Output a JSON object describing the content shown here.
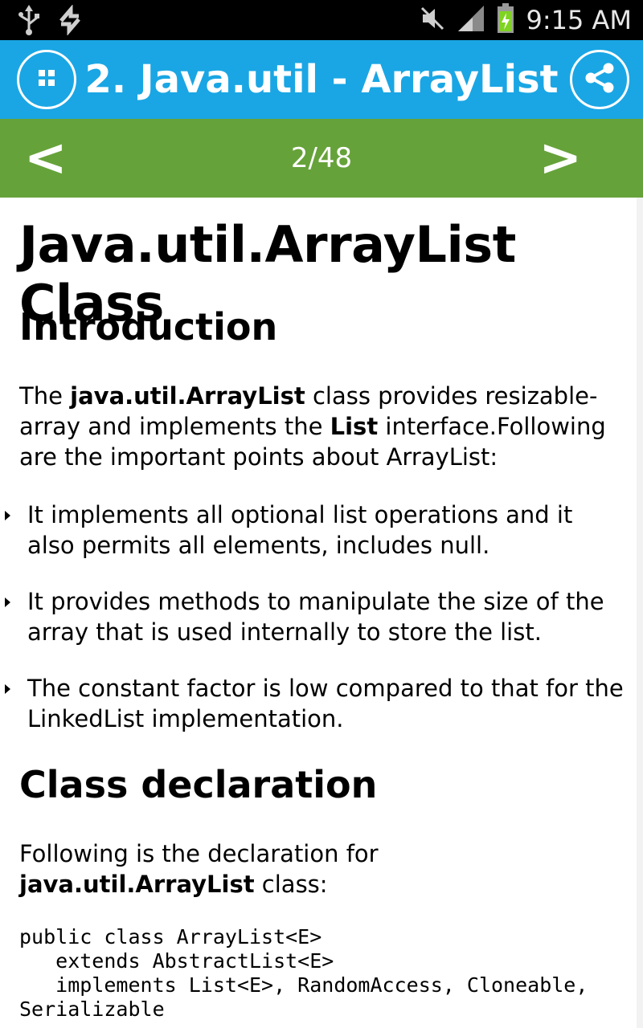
{
  "status_bar": {
    "time": "9:15 AM",
    "icons": [
      "usb-icon",
      "sync-icon",
      "mute-icon",
      "signal-icon",
      "battery-charging-icon"
    ]
  },
  "app_bar": {
    "title": "2. Java.util - ArrayList",
    "menu_icon": "grid-menu-icon",
    "share_icon": "share-icon"
  },
  "nav_bar": {
    "prev_label": "<",
    "next_label": ">",
    "page_counter": "2/48"
  },
  "article": {
    "title": "Java.util.ArrayList Class",
    "intro_heading": "Introduction",
    "intro_paragraph": {
      "part1": "The ",
      "bold1": "java.util.ArrayList",
      "part2": " class provides resizable-array and implements the ",
      "bold2": "List",
      "part3": " interface.Following are the important points about ArrayList:"
    },
    "points": [
      "It implements all optional list operations and it also permits all elements, includes null.",
      "It provides methods to manipulate the size of the array that is used internally to store the list.",
      "The constant factor is low compared to that for the LinkedList implementation."
    ],
    "declaration_heading": "Class declaration",
    "declaration_paragraph": {
      "part1": "Following is the declaration for ",
      "bold1": "java.util.ArrayList",
      "part2": " class:"
    },
    "code": "public class ArrayList<E>\n   extends AbstractList<E>\n   implements List<E>, RandomAccess, Cloneable,\nSerializable"
  }
}
